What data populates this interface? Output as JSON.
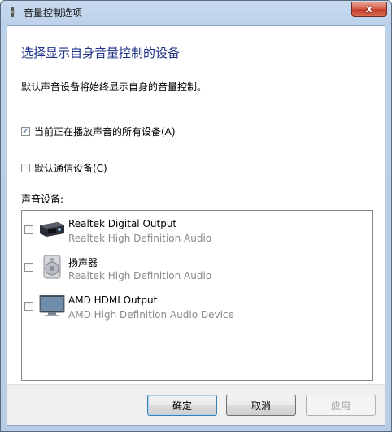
{
  "window": {
    "title": "音量控制选项",
    "close_glyph": "x"
  },
  "heading": "选择显示自身音量控制的设备",
  "description": "默认声音设备将始终显示自身的音量控制。",
  "options": [
    {
      "label": "当前正在播放声音的所有设备(A)",
      "checked": true
    },
    {
      "label": "默认通信设备(C)",
      "checked": false
    }
  ],
  "devices_label": "声音设备:",
  "devices": [
    {
      "name": "Realtek Digital Output",
      "desc": "Realtek High Definition Audio",
      "icon": "digital-output-icon",
      "checked": false
    },
    {
      "name": "扬声器",
      "desc": "Realtek High Definition Audio",
      "icon": "speaker-icon",
      "checked": false
    },
    {
      "name": "AMD HDMI Output",
      "desc": "AMD High Definition Audio Device",
      "icon": "monitor-icon",
      "checked": false
    }
  ],
  "buttons": {
    "ok": "确定",
    "cancel": "取消",
    "apply": "应用"
  }
}
